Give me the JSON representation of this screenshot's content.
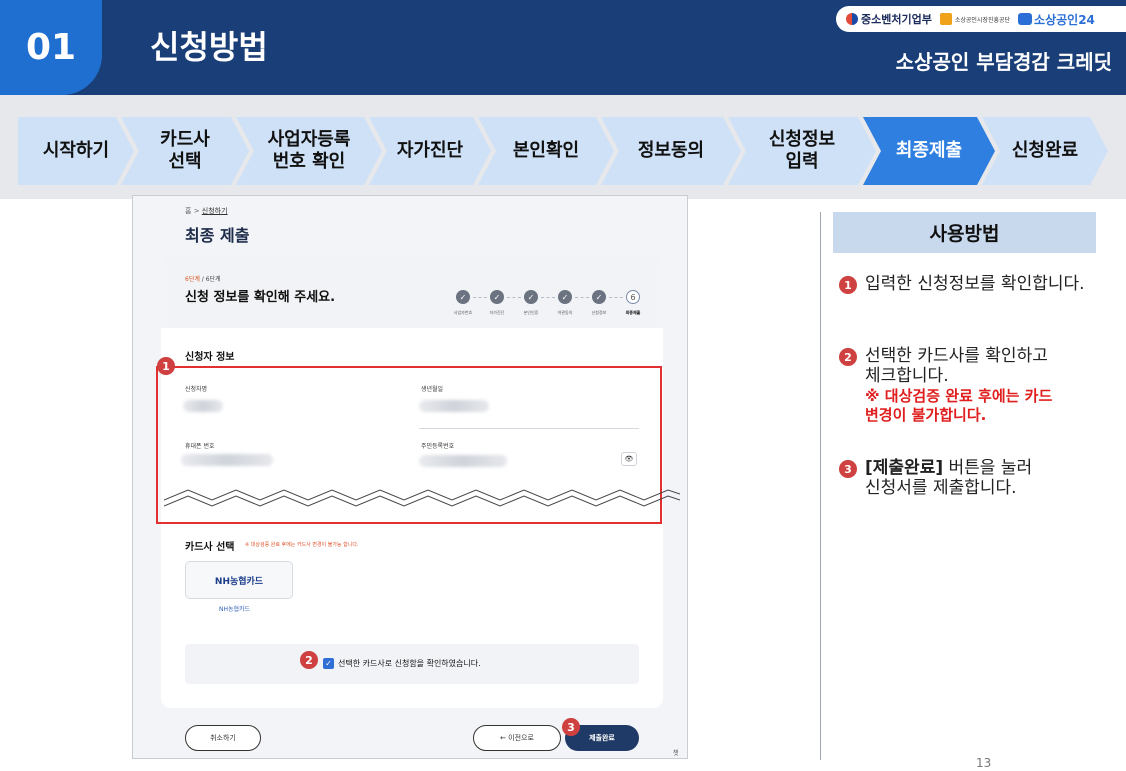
{
  "header": {
    "section_number": "01",
    "title": "신청방법",
    "subtitle": "소상공인 부담경감 크레딧",
    "logos": [
      "중소벤처기업부",
      "소상공인시장진흥공단",
      "소상공인24"
    ]
  },
  "steps": [
    {
      "label": "시작하기",
      "active": false
    },
    {
      "label": "카드사\n선택",
      "active": false
    },
    {
      "label": "사업자등록\n번호 확인",
      "active": false
    },
    {
      "label": "자가진단",
      "active": false
    },
    {
      "label": "본인확인",
      "active": false
    },
    {
      "label": "정보동의",
      "active": false
    },
    {
      "label": "신청정보\n입력",
      "active": false
    },
    {
      "label": "최종제출",
      "active": true
    },
    {
      "label": "신청완료",
      "active": false
    }
  ],
  "screen": {
    "breadcrumb_home": "홈",
    "breadcrumb_sep": ">",
    "breadcrumb_current": "신청하기",
    "page_title": "최종 제출",
    "stage_current": "6단계",
    "stage_total": " / 6단계",
    "card_heading": "신청 정보를 확인해 주세요.",
    "progress": [
      {
        "label": "사업자번호",
        "symbol": "✓"
      },
      {
        "label": "자가진단",
        "symbol": "✓"
      },
      {
        "label": "본인인증",
        "symbol": "✓"
      },
      {
        "label": "약관동의",
        "symbol": "✓"
      },
      {
        "label": "신청정보",
        "symbol": "✓"
      },
      {
        "label": "최종제출",
        "symbol": "6"
      }
    ],
    "applicant_section": "신청자 정보",
    "field_name": "신청자명",
    "field_birth": "생년월일",
    "field_phone": "휴대폰 번호",
    "field_rrn": "주민등록번호",
    "eye_symbol": "👁",
    "card_select_title": "카드사 선택",
    "card_select_note": "※ 대상검증 완료 후에는 카드사 변경이 불가능 합니다.",
    "card_logo_text": "NH농협카드",
    "card_name": "NH농협카드",
    "agree_text": "선택한 카드사로 신청함을 확인하였습니다.",
    "btn_cancel": "취소하기",
    "btn_prev": "← 이전으로",
    "btn_submit": "제출완료",
    "chat_label": "챗"
  },
  "badges": [
    "1",
    "2",
    "3"
  ],
  "usage": {
    "title": "사용방법",
    "items": [
      {
        "num": "1",
        "text": "입력한 신청정보를 확인합니다."
      },
      {
        "num": "2",
        "text_line1": "선택한 카드사를 확인하고",
        "text_line2": "체크합니다.",
        "warn_line1": "※ 대상검증 완료 후에는 카드",
        "warn_line2": "변경이 불가합니다."
      },
      {
        "num": "3",
        "bold": "[제출완료]",
        "text_line1": " 버튼을 눌러",
        "text_line2": "신청서를 제출합니다."
      }
    ]
  },
  "page_number": "13",
  "colors": {
    "header_bg": "#1a3f78",
    "accent_blue": "#2f7fe0",
    "step_bg": "#cfe1f6",
    "badge_red": "#cf4040",
    "warn_red": "#e01e1e"
  }
}
